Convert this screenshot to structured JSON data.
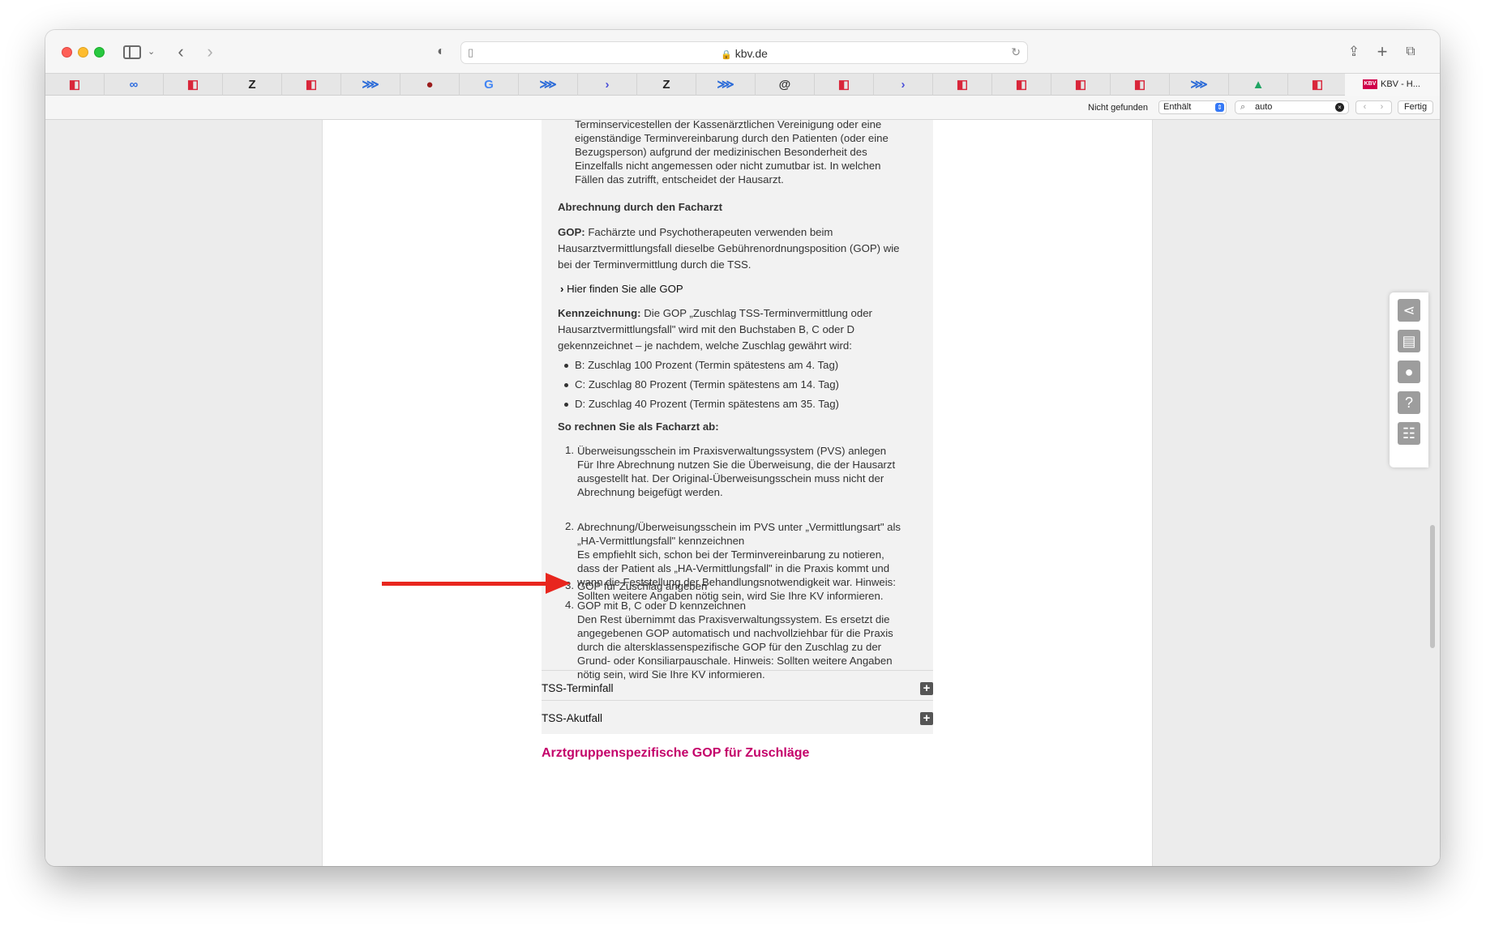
{
  "browser": {
    "url": "kbv.de",
    "active_tab_label": "KBV - H...",
    "active_tab_favicon_text": "KBV",
    "pinned_tabs": [
      {
        "icon": "office-icon",
        "glyph": "◧",
        "color": "#d9263a"
      },
      {
        "icon": "nextcloud-icon",
        "glyph": "∞",
        "color": "#2d6cdf"
      },
      {
        "icon": "office-icon",
        "glyph": "◧",
        "color": "#d9263a"
      },
      {
        "icon": "zeit-icon",
        "glyph": "Z",
        "color": "#222222"
      },
      {
        "icon": "office-icon",
        "glyph": "◧",
        "color": "#d9263a"
      },
      {
        "icon": "confluence-icon",
        "glyph": "⋙",
        "color": "#2b6bd8"
      },
      {
        "icon": "apple-icon",
        "glyph": "●",
        "color": "#9b1c1c"
      },
      {
        "icon": "google-icon",
        "glyph": "G",
        "color": "#4285f4"
      },
      {
        "icon": "confluence-icon",
        "glyph": "⋙",
        "color": "#2b6bd8"
      },
      {
        "icon": "prompt-icon",
        "glyph": "›",
        "color": "#4a4fd8"
      },
      {
        "icon": "zeit-icon",
        "glyph": "Z",
        "color": "#222222"
      },
      {
        "icon": "confluence-icon",
        "glyph": "⋙",
        "color": "#2b6bd8"
      },
      {
        "icon": "at-icon",
        "glyph": "@",
        "color": "#333333"
      },
      {
        "icon": "office-icon",
        "glyph": "◧",
        "color": "#d9263a"
      },
      {
        "icon": "prompt-icon",
        "glyph": "›",
        "color": "#4a4fd8"
      },
      {
        "icon": "office-icon",
        "glyph": "◧",
        "color": "#d9263a"
      },
      {
        "icon": "office-icon",
        "glyph": "◧",
        "color": "#d9263a"
      },
      {
        "icon": "office-icon",
        "glyph": "◧",
        "color": "#d9263a"
      },
      {
        "icon": "office-icon",
        "glyph": "◧",
        "color": "#d9263a"
      },
      {
        "icon": "confluence-icon",
        "glyph": "⋙",
        "color": "#2b6bd8"
      },
      {
        "icon": "drive-icon",
        "glyph": "▲",
        "color": "#1fa463"
      },
      {
        "icon": "office-icon",
        "glyph": "◧",
        "color": "#d9263a"
      }
    ]
  },
  "findbar": {
    "status": "Nicht gefunden",
    "mode": "Enthält",
    "query": "auto",
    "done": "Fertig"
  },
  "content": {
    "intro_lines": [
      "Terminservicestellen der Kassenärztlichen Vereinigung oder eine",
      "eigenständige Terminvereinbarung durch den Patienten (oder eine",
      "Bezugsperson) aufgrund der medizinischen Besonderheit des",
      "Einzelfalls nicht angemessen oder nicht zumutbar ist. In welchen",
      "Fällen das zutrifft, entscheidet der Hausarzt."
    ],
    "heading_abrechnung": "Abrechnung durch den Facharzt",
    "gop_label": "GOP:",
    "gop_lines": [
      " Fachärzte und Psychotherapeuten verwenden beim",
      "Hausarztvermittlungsfall dieselbe Gebührenordnungsposition (GOP) wie",
      "bei der Terminvermittlung durch die TSS."
    ],
    "gop_link": "Hier finden Sie alle GOP",
    "kenn_label": "Kennzeichnung:",
    "kenn_lines": [
      " Die GOP „Zuschlag TSS-Terminvermittlung oder",
      "Hausarztvermittlungsfall\" wird mit den Buchstaben B, C oder D",
      "gekennzeichnet – je nachdem, welche Zuschlag gewährt wird:"
    ],
    "bullets": [
      "B: Zuschlag 100 Prozent (Termin spätestens am 4. Tag)",
      "C: Zuschlag 80 Prozent (Termin spätestens am 14. Tag)",
      "D: Zuschlag 40 Prozent (Termin spätestens am 35. Tag)"
    ],
    "heading_steps": "So rechnen Sie als Facharzt ab:",
    "steps": [
      {
        "num": "1.",
        "lines": [
          "Überweisungsschein im Praxisverwaltungssystem (PVS) anlegen",
          "Für Ihre Abrechnung nutzen Sie die Überweisung, die der Hausarzt",
          "ausgestellt hat. Der Original-Überweisungsschein muss nicht der",
          "Abrechnung beigefügt werden."
        ]
      },
      {
        "num": "2.",
        "lines": [
          "Abrechnung/Überweisungsschein im PVS unter „Vermittlungsart\" als",
          "„HA-Vermittlungsfall\" kennzeichnen",
          "Es empfiehlt sich, schon bei der Terminvereinbarung zu notieren,",
          "dass der Patient als „HA-Vermittlungsfall\" in die Praxis kommt und",
          "wann die Feststellung der Behandlungsnotwendigkeit war. Hinweis:",
          "Sollten weitere Angaben nötig sein, wird Sie Ihre KV informieren."
        ]
      },
      {
        "num": "3.",
        "lines": [
          "GOP für Zuschlag angeben"
        ]
      },
      {
        "num": "4.",
        "lines": [
          "GOP mit B, C oder D kennzeichnen",
          "Den Rest übernimmt das Praxisverwaltungssystem. Es ersetzt die",
          "angegebenen GOP automatisch und nachvollziehbar für die Praxis",
          "durch die altersklassenspezifische GOP für den Zuschlag zu der",
          "Grund- oder Konsiliarpauschale. Hinweis: Sollten weitere Angaben",
          "nötig sein, wird Sie Ihre KV informieren."
        ]
      }
    ],
    "accordion": [
      "TSS-Terminfall",
      "TSS-Akutfall"
    ],
    "section_title": "Arztgruppenspezifische GOP für Zuschläge"
  },
  "colors": {
    "accent": "#c4006a",
    "annotation_arrow": "#e8261e"
  }
}
